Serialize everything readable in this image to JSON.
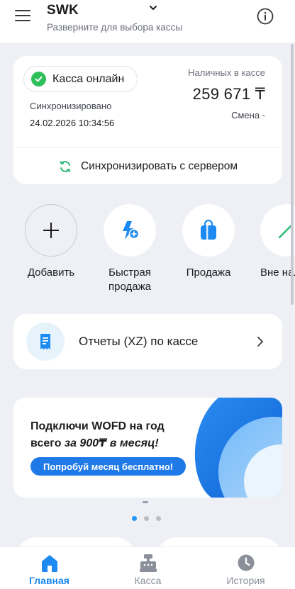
{
  "header": {
    "title": "SWK",
    "subtitle": "Разверните для выбора кассы",
    "menu_icon": "hamburger-menu-icon",
    "info_icon": "info-icon"
  },
  "status": {
    "online_label": "Касса онлайн",
    "synced_label": "Синхронизировано",
    "synced_at": "24.02.2026 10:34:56",
    "cash_label": "Наличных в кассе",
    "cash_value": "259 671 ₸",
    "shift_label": "Смена -",
    "sync_button": "Синхронизировать с сервером"
  },
  "actions": [
    {
      "label": "Добавить",
      "icon": "plus-icon"
    },
    {
      "label": "Быстрая продажа",
      "icon": "lightning-plus-icon"
    },
    {
      "label": "Продажа",
      "icon": "shopping-bag-icon"
    },
    {
      "label": "Вне нали",
      "icon": "arrow-icon"
    }
  ],
  "reports": {
    "label": "Отчеты (XZ) по кассе",
    "icon": "receipt-icon"
  },
  "banner": {
    "line1": "Подключи WOFD на год",
    "line2_prefix": "всего",
    "line2_emphasis": "за 900₸ в месяц!",
    "cta": "Попробуй месяц бесплатно!"
  },
  "pager": {
    "total": 3,
    "active": 1
  },
  "bottom_nav": [
    {
      "label": "Главная",
      "icon": "home-icon",
      "active": true
    },
    {
      "label": "Касса",
      "icon": "cash-register-icon",
      "active": false
    },
    {
      "label": "История",
      "icon": "clock-icon",
      "active": false
    }
  ],
  "colors": {
    "accent": "#1c8af0",
    "online_green": "#2fbf5a",
    "background": "#eef0f5",
    "cta_blue": "#1f7ae8"
  }
}
